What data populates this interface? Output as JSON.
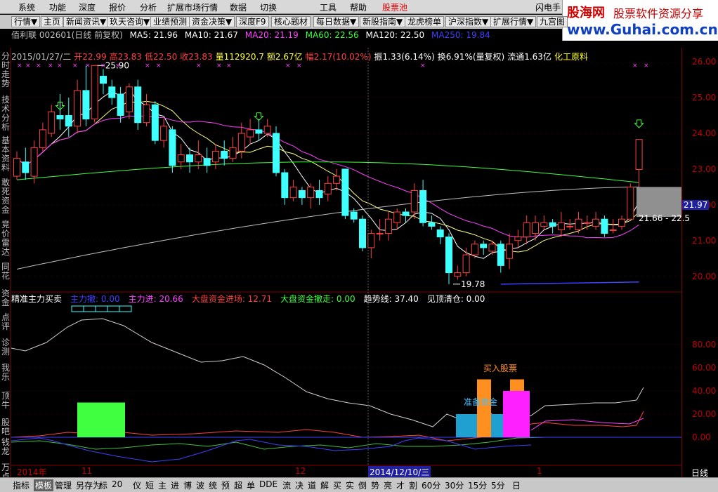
{
  "menu": [
    "系统",
    "功能",
    "深度",
    "报价",
    "分析",
    "扩展市场行情",
    "数据",
    "切换",
    "工具",
    "帮助",
    "股票池",
    "闪电手"
  ],
  "toolbar": [
    "行情▼",
    "主页",
    "新闻资讯▼",
    "玖天咨询▼",
    "业绩预测",
    "资金决策▼",
    "深度F9",
    "核心题材",
    "每日数据▼",
    "新股指南▼",
    "龙虎榜单",
    "沪深指数▼",
    "扩展行情▼",
    "九宫图"
  ],
  "logo": {
    "cn": "股海网",
    "slogan": "股票软件资源分享",
    "url": "www.Guhai.com.cn"
  },
  "stock": {
    "title": "佰利联 002601(日线 前复权)",
    "ma": [
      {
        "label": "MA5: 21.96",
        "color": "#ffffff"
      },
      {
        "label": "MA10: 21.67",
        "color": "#ffffff"
      },
      {
        "label": "MA20: 21.19",
        "color": "#ff40ff"
      },
      {
        "label": "MA60: 22.56",
        "color": "#40ff40"
      },
      {
        "label": "MA120: 22.50",
        "color": "#ffffff"
      },
      {
        "label": "MA250: 19.84",
        "color": "#4040ff"
      }
    ]
  },
  "pricebar": [
    {
      "t": "2015/01/27/二",
      "c": "#c0c0c0"
    },
    {
      "t": "开22.99",
      "c": "#ff4040"
    },
    {
      "t": "高23.83",
      "c": "#ff4040"
    },
    {
      "t": "低22.50",
      "c": "#ff4040"
    },
    {
      "t": "收23.83",
      "c": "#ff4040"
    },
    {
      "t": "量112920.7",
      "c": "#ffff40"
    },
    {
      "t": "额2.67亿",
      "c": "#ffff40"
    },
    {
      "t": "幅2.17(10.02%)",
      "c": "#ff4040"
    },
    {
      "t": "振1.33(6.14%)",
      "c": "#ffffff"
    },
    {
      "t": "换6.91%(量复权)",
      "c": "#ffffff"
    },
    {
      "t": "流通1.63亿",
      "c": "#ffffff"
    },
    {
      "t": "化工原料",
      "c": "#ffff40"
    }
  ],
  "indicator": [
    {
      "t": "精准主力买卖",
      "c": "#ffffff"
    },
    {
      "t": "主力撤: 0.00",
      "c": "#4040ff"
    },
    {
      "t": "主力进: 20.66",
      "c": "#ff40ff"
    },
    {
      "t": "大盘资金进场: 12.71",
      "c": "#ff4040"
    },
    {
      "t": "大盘资金撤走: 0.00",
      "c": "#40ff40"
    },
    {
      "t": "趋势线: 37.40",
      "c": "#ffffff"
    },
    {
      "t": "见顶清仓: 0.00",
      "c": "#ffffff"
    }
  ],
  "sidebar": [
    "分时走势",
    "技术分析",
    "基本资料",
    "敢死资金",
    "竞价雷达",
    "同花",
    "资金",
    "点评",
    "诊测",
    "我乐",
    "顶牛",
    "股吧",
    "钱龙",
    "万点"
  ],
  "price_axis": [
    "26.00",
    "25.00",
    "24.00",
    "23.00",
    "22.00",
    "21.00",
    "20.00"
  ],
  "current_price": "21.97",
  "ind_axis": [
    "80.00",
    "60.00",
    "40.00",
    "20.00",
    "0.00"
  ],
  "annotations": {
    "high": "25.90",
    "low": "19.78",
    "range": "21.66 - 22.5",
    "buy": "买入股票",
    "prepare": "准备资金"
  },
  "dates": {
    "year": "2014年",
    "m11": "11",
    "m12": "12",
    "cursor": "2014/12/10/三",
    "m1": "1",
    "period": "日线"
  },
  "bottom": [
    "指标",
    "模板",
    "管理",
    "另存为",
    "标",
    "20",
    "仪",
    "短",
    "主",
    "进",
    "博",
    "波",
    "统",
    "预",
    "超",
    "单",
    "DDE",
    "流",
    "决",
    "道",
    "解",
    "买",
    "实",
    "倒",
    "势",
    "亮",
    "才",
    "割",
    "60分",
    "30分",
    "15分",
    "5分",
    "日"
  ],
  "chart_data": {
    "type": "candlestick",
    "candles": [
      [
        22.8,
        23.3,
        23.5,
        22.7
      ],
      [
        23.2,
        22.9,
        23.6,
        22.7
      ],
      [
        22.8,
        23.6,
        23.8,
        22.6
      ],
      [
        23.6,
        24.1,
        24.3,
        23.5
      ],
      [
        24.0,
        24.6,
        24.8,
        23.9
      ],
      [
        24.5,
        24.4,
        25.1,
        24.1
      ],
      [
        24.5,
        24.2,
        25.0,
        23.9
      ],
      [
        24.2,
        25.2,
        25.5,
        24.0
      ],
      [
        25.2,
        24.4,
        25.9,
        24.2
      ],
      [
        24.4,
        25.9,
        25.9,
        24.3
      ],
      [
        25.6,
        25.4,
        25.8,
        25.1
      ],
      [
        25.3,
        25.0,
        25.5,
        24.8
      ],
      [
        25.1,
        24.5,
        25.3,
        24.3
      ],
      [
        24.6,
        25.3,
        25.4,
        24.4
      ],
      [
        25.3,
        24.3,
        25.5,
        24.1
      ],
      [
        24.3,
        24.8,
        25.1,
        24.2
      ],
      [
        24.8,
        23.8,
        24.9,
        23.7
      ],
      [
        23.8,
        24.2,
        24.4,
        23.6
      ],
      [
        24.1,
        23.1,
        24.2,
        22.9
      ],
      [
        23.2,
        23.4,
        23.7,
        23.0
      ],
      [
        23.4,
        23.2,
        23.6,
        22.9
      ],
      [
        23.2,
        23.4,
        23.8,
        23.0
      ],
      [
        23.3,
        23.1,
        23.6,
        22.9
      ],
      [
        23.2,
        23.5,
        23.7,
        23.0
      ],
      [
        23.5,
        23.3,
        23.8,
        23.1
      ],
      [
        23.3,
        23.6,
        23.9,
        23.2
      ],
      [
        23.5,
        24.0,
        24.3,
        23.3
      ],
      [
        23.9,
        24.1,
        24.4,
        23.7
      ],
      [
        24.1,
        24.0,
        24.4,
        23.8
      ],
      [
        24.0,
        24.2,
        24.4,
        23.9
      ],
      [
        24.0,
        22.9,
        24.2,
        22.8
      ],
      [
        22.9,
        22.2,
        23.0,
        22.0
      ],
      [
        22.2,
        22.5,
        22.7,
        22.1
      ],
      [
        22.4,
        22.2,
        22.5,
        22.0
      ],
      [
        22.2,
        22.5,
        22.6,
        21.9
      ],
      [
        22.4,
        22.2,
        22.7,
        22.0
      ],
      [
        22.3,
        22.6,
        22.8,
        22.1
      ],
      [
        22.6,
        22.8,
        23.0,
        22.4
      ],
      [
        23.0,
        21.7,
        23.0,
        21.6
      ],
      [
        21.8,
        21.6,
        21.9,
        21.5
      ],
      [
        21.6,
        20.8,
        21.7,
        20.7
      ],
      [
        20.8,
        21.2,
        21.3,
        20.5
      ],
      [
        21.2,
        21.2,
        21.6,
        21.0
      ],
      [
        21.2,
        21.6,
        21.8,
        21.0
      ],
      [
        21.5,
        21.8,
        21.9,
        21.3
      ],
      [
        21.8,
        21.7,
        21.9,
        21.5
      ],
      [
        21.8,
        22.4,
        22.6,
        21.6
      ],
      [
        22.4,
        21.5,
        22.7,
        21.4
      ],
      [
        21.5,
        21.4,
        21.7,
        21.3
      ],
      [
        21.3,
        21.1,
        21.4,
        20.9
      ],
      [
        21.1,
        20.1,
        21.2,
        19.78
      ],
      [
        20.0,
        20.1,
        20.3,
        19.9
      ],
      [
        20.1,
        20.6,
        20.8,
        20.0
      ],
      [
        20.6,
        20.9,
        21.0,
        20.5
      ],
      [
        20.9,
        20.8,
        21.0,
        20.6
      ],
      [
        20.7,
        20.9,
        21.0,
        20.6
      ],
      [
        20.9,
        20.3,
        21.0,
        20.1
      ],
      [
        20.5,
        20.9,
        21.2,
        20.2
      ],
      [
        21.0,
        21.1,
        21.3,
        20.8
      ],
      [
        21.1,
        21.5,
        21.7,
        20.9
      ],
      [
        21.2,
        21.5,
        21.7,
        21.0
      ],
      [
        21.4,
        21.5,
        21.7,
        21.3
      ],
      [
        21.5,
        21.4,
        21.6,
        21.2
      ],
      [
        21.3,
        21.5,
        21.8,
        21.1
      ],
      [
        21.4,
        21.4,
        21.6,
        21.3
      ],
      [
        21.3,
        21.6,
        21.8,
        21.2
      ],
      [
        21.5,
        21.5,
        21.7,
        21.3
      ],
      [
        21.4,
        21.6,
        21.8,
        21.3
      ],
      [
        21.6,
        21.2,
        21.7,
        21.1
      ],
      [
        21.3,
        21.3,
        21.6,
        21.2
      ],
      [
        21.4,
        21.6,
        21.7,
        21.3
      ],
      [
        21.6,
        22.5,
        22.6,
        21.6
      ],
      [
        22.99,
        23.83,
        23.83,
        22.5
      ]
    ],
    "ylim": [
      19.6,
      26.2
    ]
  }
}
